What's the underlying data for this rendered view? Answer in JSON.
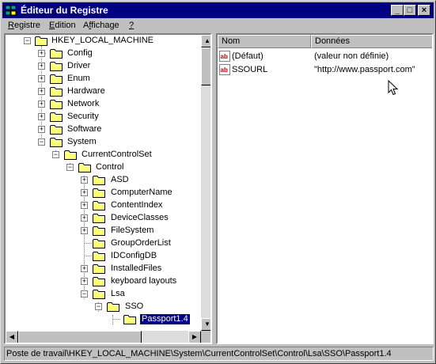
{
  "window": {
    "title": "Éditeur du Registre",
    "minimize": "_",
    "maximize": "□",
    "close": "×"
  },
  "menu": [
    {
      "u": "R",
      "rest": "egistre"
    },
    {
      "u": "E",
      "rest": "dition"
    },
    {
      "pre": "A",
      "u": "f",
      "rest": "fichage"
    },
    {
      "u": "?",
      "rest": ""
    }
  ],
  "tree": {
    "root": "HKEY_LOCAL_MACHINE",
    "level1": [
      "Config",
      "Driver",
      "Enum",
      "Hardware",
      "Network",
      "Security",
      "Software",
      "System"
    ],
    "currentcontrolset": "CurrentControlSet",
    "control": "Control",
    "control_children": [
      "ASD",
      "ComputerName",
      "ContentIndex",
      "DeviceClasses",
      "FileSystem",
      "GroupOrderList",
      "IDConfigDB",
      "InstalledFiles",
      "keyboard layouts",
      "Lsa"
    ],
    "sso": "SSO",
    "selected": "Passport1.4"
  },
  "list": {
    "col_name": "Nom",
    "col_data": "Données",
    "rows": [
      {
        "name": "(Défaut)",
        "data": "(valeur non définie)"
      },
      {
        "name": "SSOURL",
        "data": "\"http://www.passport.com\""
      }
    ]
  },
  "status": "Poste de travail\\HKEY_LOCAL_MACHINE\\System\\CurrentControlSet\\Control\\Lsa\\SSO\\Passport1.4",
  "colors": {
    "titlebar": "#000080",
    "face": "#c0c0c0",
    "folder": "#ffff80",
    "selection": "#000080"
  }
}
